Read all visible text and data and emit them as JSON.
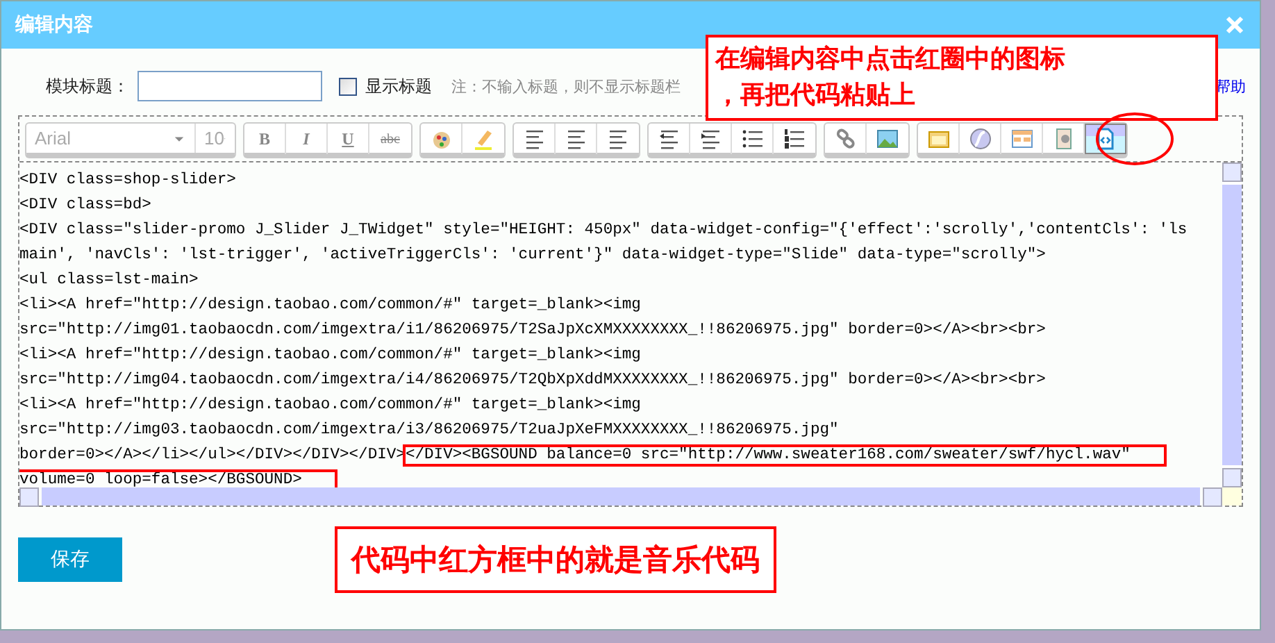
{
  "window": {
    "title": "编辑内容"
  },
  "form": {
    "title_label": "模块标题：",
    "show_title": {
      "label": "显示标题",
      "checked": false
    },
    "hint": "注：不输入标题，则不显示标题栏",
    "help_link": "帮助"
  },
  "toolbar": {
    "font": "Arial",
    "size": "10",
    "format_buttons": [
      "B",
      "I",
      "U",
      "abc"
    ],
    "source_button": {
      "active": true
    }
  },
  "code_lines": [
    {
      "segments": [
        {
          "text": "<DIV class=shop-slider>",
          "highlighted": false
        }
      ]
    },
    {
      "segments": [
        {
          "text": "<DIV class=bd>",
          "highlighted": false
        }
      ]
    },
    {
      "segments": [
        {
          "text": "<DIV class=\"slider-promo J_Slider J_TWidget\" style=\"HEIGHT: 450px\" data-widget-config=\"{'effect':'scrolly','contentCls': 'ls",
          "highlighted": false
        }
      ]
    },
    {
      "segments": [
        {
          "text": "main', 'navCls': 'lst-trigger', 'activeTriggerCls': 'current'}\" data-widget-type=\"Slide\" data-type=\"scrolly\">",
          "highlighted": false
        }
      ]
    },
    {
      "segments": [
        {
          "text": "<ul class=lst-main>",
          "highlighted": false
        }
      ]
    },
    {
      "segments": [
        {
          "text": "<li><A href=\"http://design.taobao.com/common/#\" target=_blank><img",
          "highlighted": false
        }
      ]
    },
    {
      "segments": [
        {
          "text": "src=\"http://img01.taobaocdn.com/imgextra/i1/86206975/T2SaJpXcXMXXXXXXXX_!!86206975.jpg\" border=0></A><br><br>",
          "highlighted": false
        }
      ]
    },
    {
      "segments": [
        {
          "text": "<li><A href=\"http://design.taobao.com/common/#\" target=_blank><img",
          "highlighted": false
        }
      ]
    },
    {
      "segments": [
        {
          "text": "src=\"http://img04.taobaocdn.com/imgextra/i4/86206975/T2QbXpXddMXXXXXXXX_!!86206975.jpg\" border=0></A><br><br>",
          "highlighted": false
        }
      ]
    },
    {
      "segments": [
        {
          "text": "<li><A href=\"http://design.taobao.com/common/#\" target=_blank><img",
          "highlighted": false
        }
      ]
    },
    {
      "segments": [
        {
          "text": "src=\"http://img03.taobaocdn.com/imgextra/i3/86206975/T2uaJpXeFMXXXXXXXX_!!86206975.jpg\"",
          "highlighted": false
        }
      ]
    },
    {
      "segments": [
        {
          "text": "border=0></A></li></ul></DIV></DIV></DIV>",
          "highlighted": false
        },
        {
          "text": "</DIV><BGSOUND balance=0 src=\"http://www.sweater168.com/sweater/swf/hycl.wav\"",
          "highlighted": true
        }
      ]
    },
    {
      "segments": [
        {
          "text": "volume=0 loop=false></BGSOUND>",
          "highlighted": true
        }
      ]
    }
  ],
  "save_button": "保存",
  "annotations": {
    "callout": [
      "在编辑内容中点击红圈中的图标",
      "，再把代码粘贴上"
    ],
    "note": "代码中红方框中的就是音乐代码"
  }
}
